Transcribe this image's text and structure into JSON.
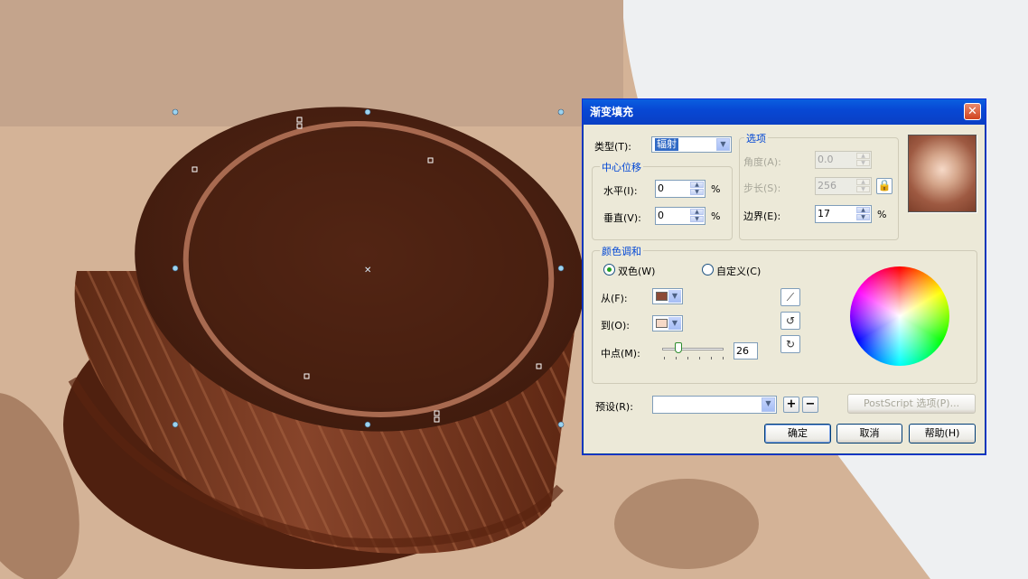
{
  "dialog": {
    "title": "渐变填充",
    "close_glyph": "✕",
    "type_label": "类型(T):",
    "type_value": "辐射",
    "center_group_title": "中心位移",
    "horizontal_label": "水平(I):",
    "horizontal_value": "0",
    "vertical_label": "垂直(V):",
    "vertical_value": "0",
    "percent": "%",
    "options_group_title": "选项",
    "angle_label": "角度(A):",
    "angle_value": "0.0",
    "steps_label": "步长(S):",
    "steps_value": "256",
    "edge_label": "边界(E):",
    "edge_value": "17",
    "color_group_title": "颜色调和",
    "two_color_label": "双色(W)",
    "custom_label": "自定义(C)",
    "from_label": "从(F):",
    "from_color": "#8c4a36",
    "to_label": "到(O):",
    "to_color": "#f6d9c7",
    "midpoint_label": "中点(M):",
    "midpoint_value": "26",
    "midpoint_fraction": 0.26,
    "presets_label": "预设(R):",
    "presets_value": "",
    "add_preset": "+",
    "remove_preset": "−",
    "postscript_label": "PostScript 选项(P)...",
    "ok_label": "确定",
    "cancel_label": "取消",
    "help_label": "帮助(H)"
  },
  "canvas": {
    "background_top": "#c4a48c",
    "background_main": "#d8b89c",
    "side_panel": "#eef0f2",
    "cookie_side": "#7a3a1e",
    "cookie_top": "#4e2213"
  }
}
